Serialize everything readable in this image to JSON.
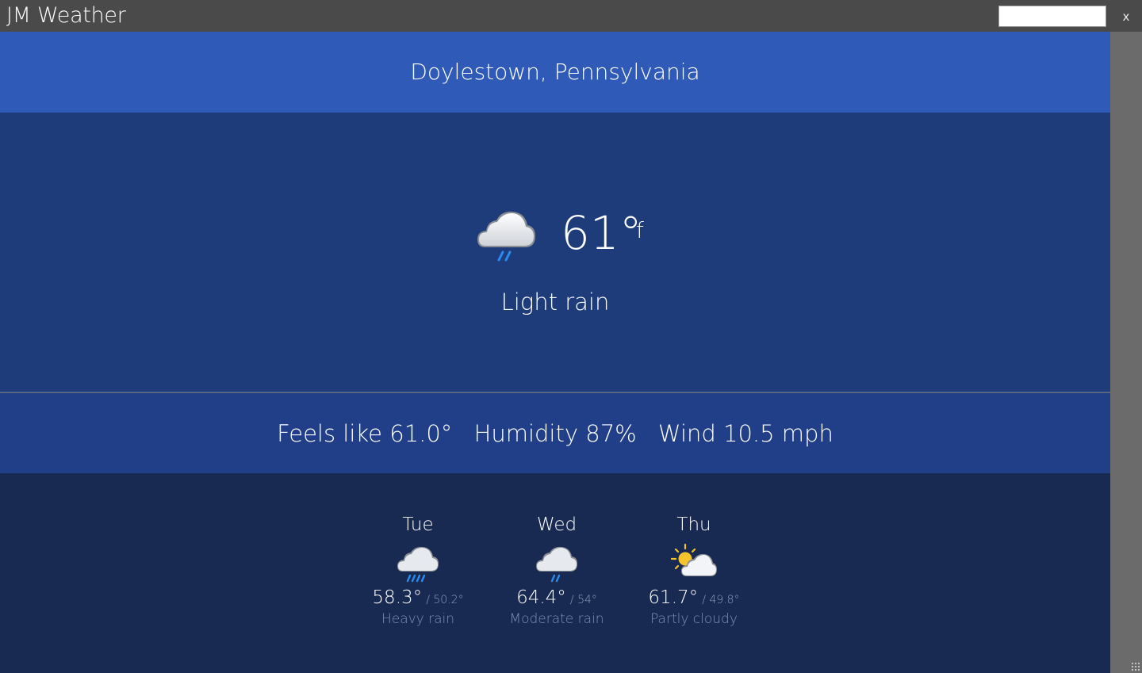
{
  "app": {
    "title": "JM Weather",
    "search_value": "",
    "close_label": "x"
  },
  "location": "Doylestown, Pennsylvania",
  "current": {
    "icon": "light-rain-icon",
    "temperature": "61°",
    "unit": "f",
    "condition": "Light rain",
    "feels_like": "Feels like 61.0°",
    "humidity": "Humidity 87%",
    "wind": "Wind 10.5 mph"
  },
  "forecast": [
    {
      "day": "Tue",
      "icon": "heavy-rain-icon",
      "high": "58.3°",
      "low": "/ 50.2°",
      "condition": "Heavy rain"
    },
    {
      "day": "Wed",
      "icon": "moderate-rain-icon",
      "high": "64.4°",
      "low": "/ 54°",
      "condition": "Moderate rain"
    },
    {
      "day": "Thu",
      "icon": "partly-cloudy-icon",
      "high": "61.7°",
      "low": "/ 49.8°",
      "condition": "Partly cloudy"
    }
  ],
  "colors": {
    "titlebar": "#4a4a4a",
    "location_band": "#2f5ab7",
    "current_band": "#1e3c7a",
    "details_band": "#213f88",
    "forecast_band": "#182a52",
    "rain_drop": "#2a8cf0",
    "sun": "#f5c32c"
  }
}
